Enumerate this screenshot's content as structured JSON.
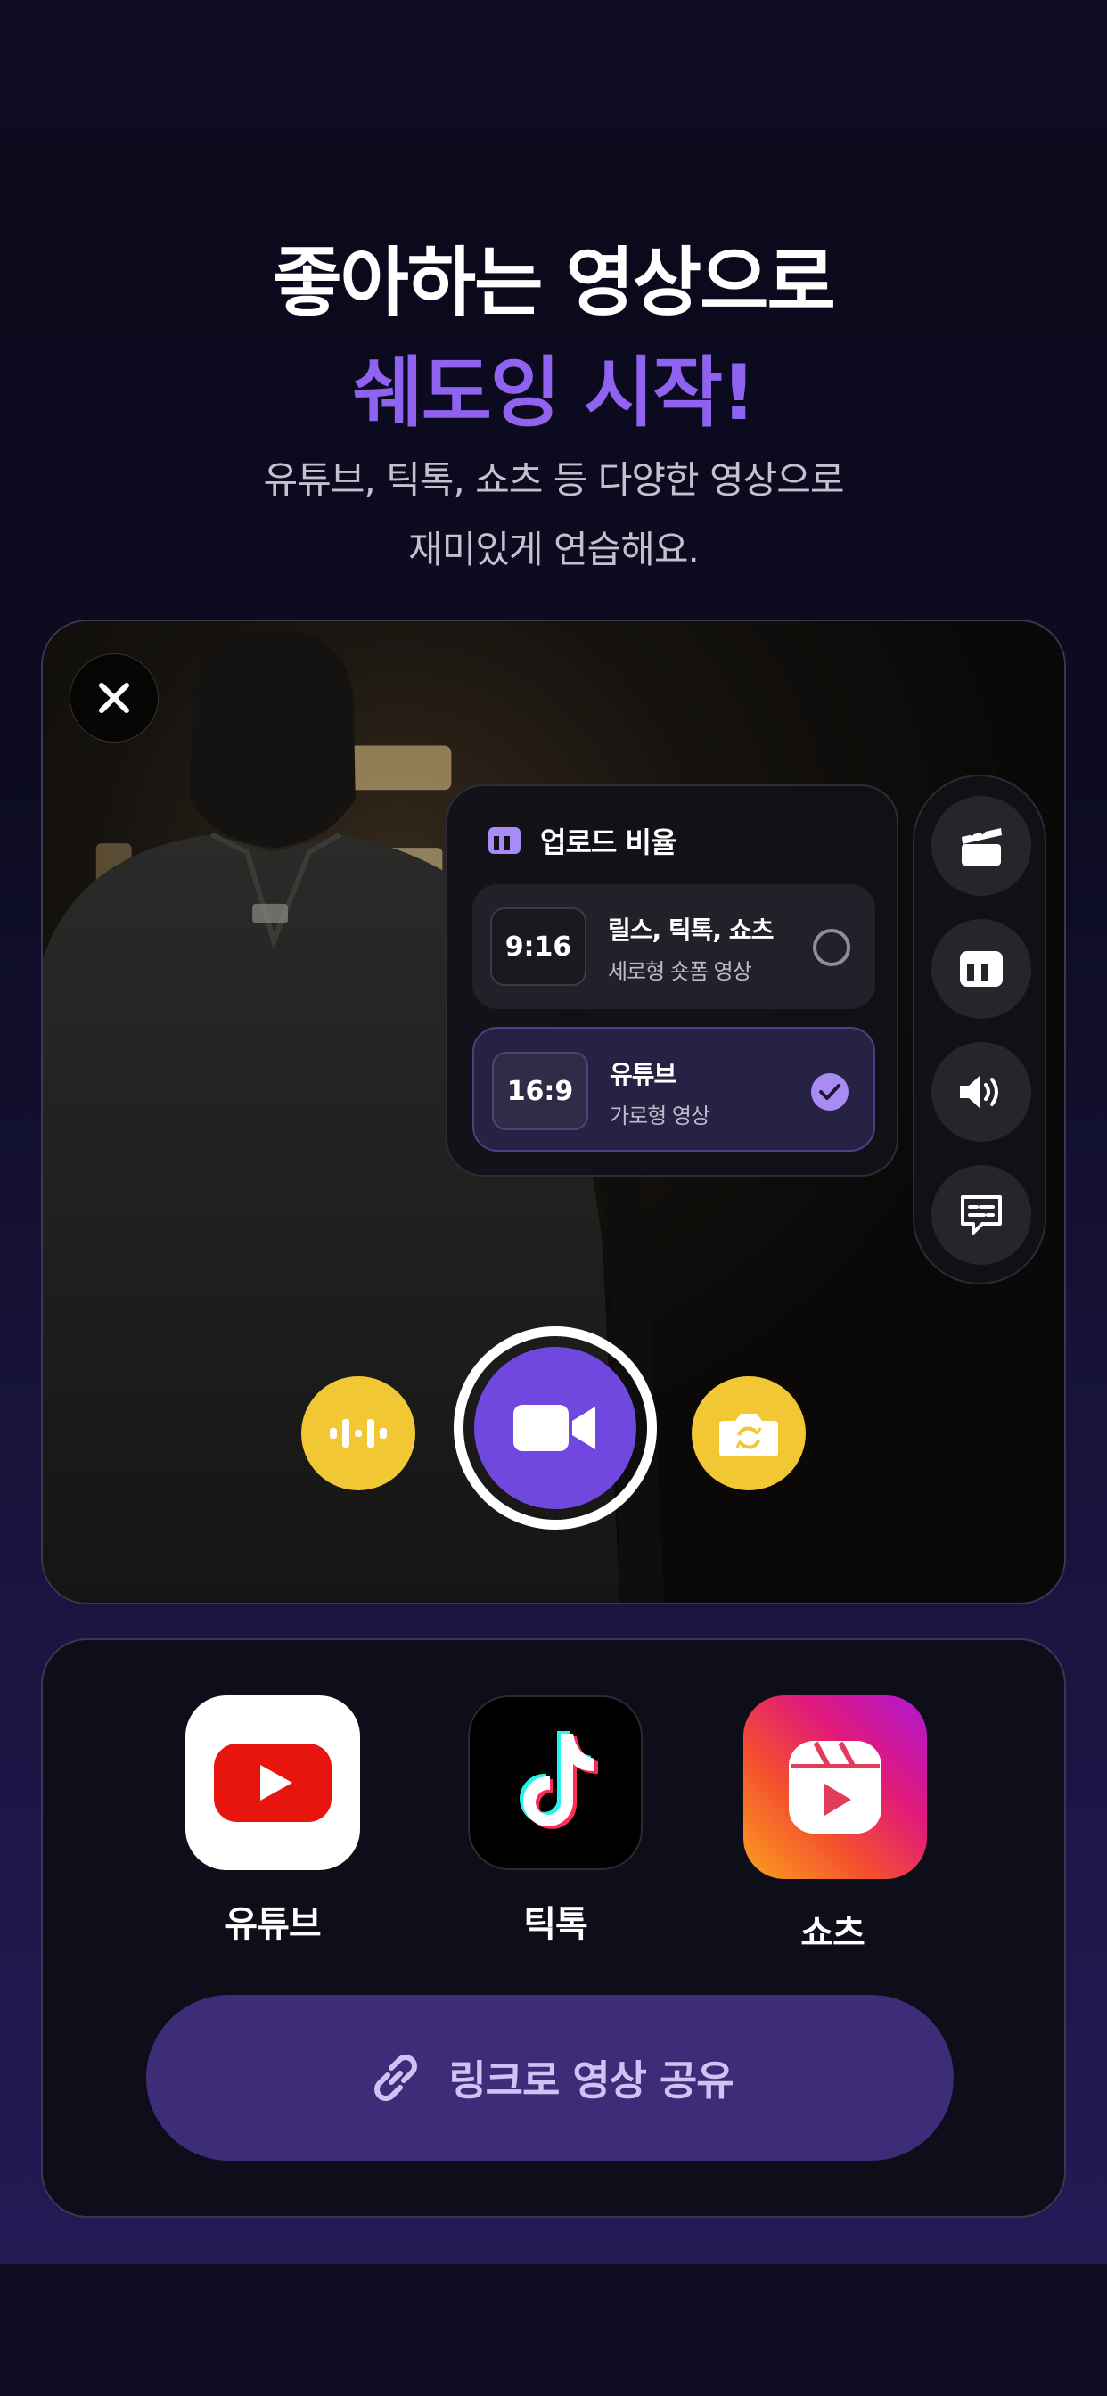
{
  "headline": {
    "line1": "좋아하는 영상으로",
    "line2": "쉐도잉 시작!"
  },
  "subtext": {
    "line1": "유튜브, 틱톡, 쇼츠 등 다양한 영상으로",
    "line2": "재미있게 연습해요."
  },
  "preview": {
    "close_icon": "close-icon",
    "ratio_panel": {
      "title": "업로드 비율",
      "options": [
        {
          "ratio": "9:16",
          "name": "릴스, 틱톡, 쇼츠",
          "desc": "세로형 숏폼 영상",
          "selected": false
        },
        {
          "ratio": "16:9",
          "name": "유튜브",
          "desc": "가로형 영상",
          "selected": true
        }
      ]
    },
    "side_tools": [
      "clapperboard-icon",
      "ratio-icon",
      "volume-icon",
      "subtitle-icon"
    ],
    "controls": {
      "left": "equalizer-icon",
      "center": "video-camera-icon",
      "right": "camera-flip-icon"
    },
    "accent_color": "#7048e0",
    "button_yellow": "#f2c734"
  },
  "share": {
    "apps": [
      {
        "label": "유튜브",
        "icon": "youtube-icon",
        "color": "#ff0000"
      },
      {
        "label": "틱톡",
        "icon": "tiktok-icon",
        "color": "#000000"
      },
      {
        "label": "쇼츠",
        "icon": "reels-icon",
        "color": "#e1306c"
      }
    ],
    "link_button": "링크로 영상 공유"
  }
}
